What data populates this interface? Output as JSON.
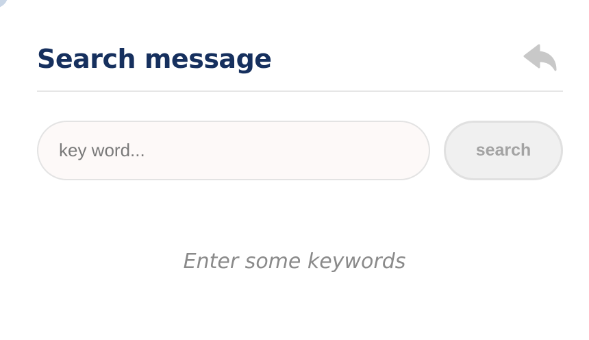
{
  "header": {
    "title": "Search message",
    "back_icon": "reply-arrow-icon"
  },
  "search": {
    "placeholder": "key word...",
    "value": "",
    "button_label": "search"
  },
  "results": {
    "empty_text": "Enter some keywords"
  },
  "colors": {
    "title": "#16305e",
    "icon": "#c8c8c8",
    "input_bg": "#fdf9f8",
    "button_bg": "#f0f0f0",
    "hint_text": "#8a8a8a"
  }
}
